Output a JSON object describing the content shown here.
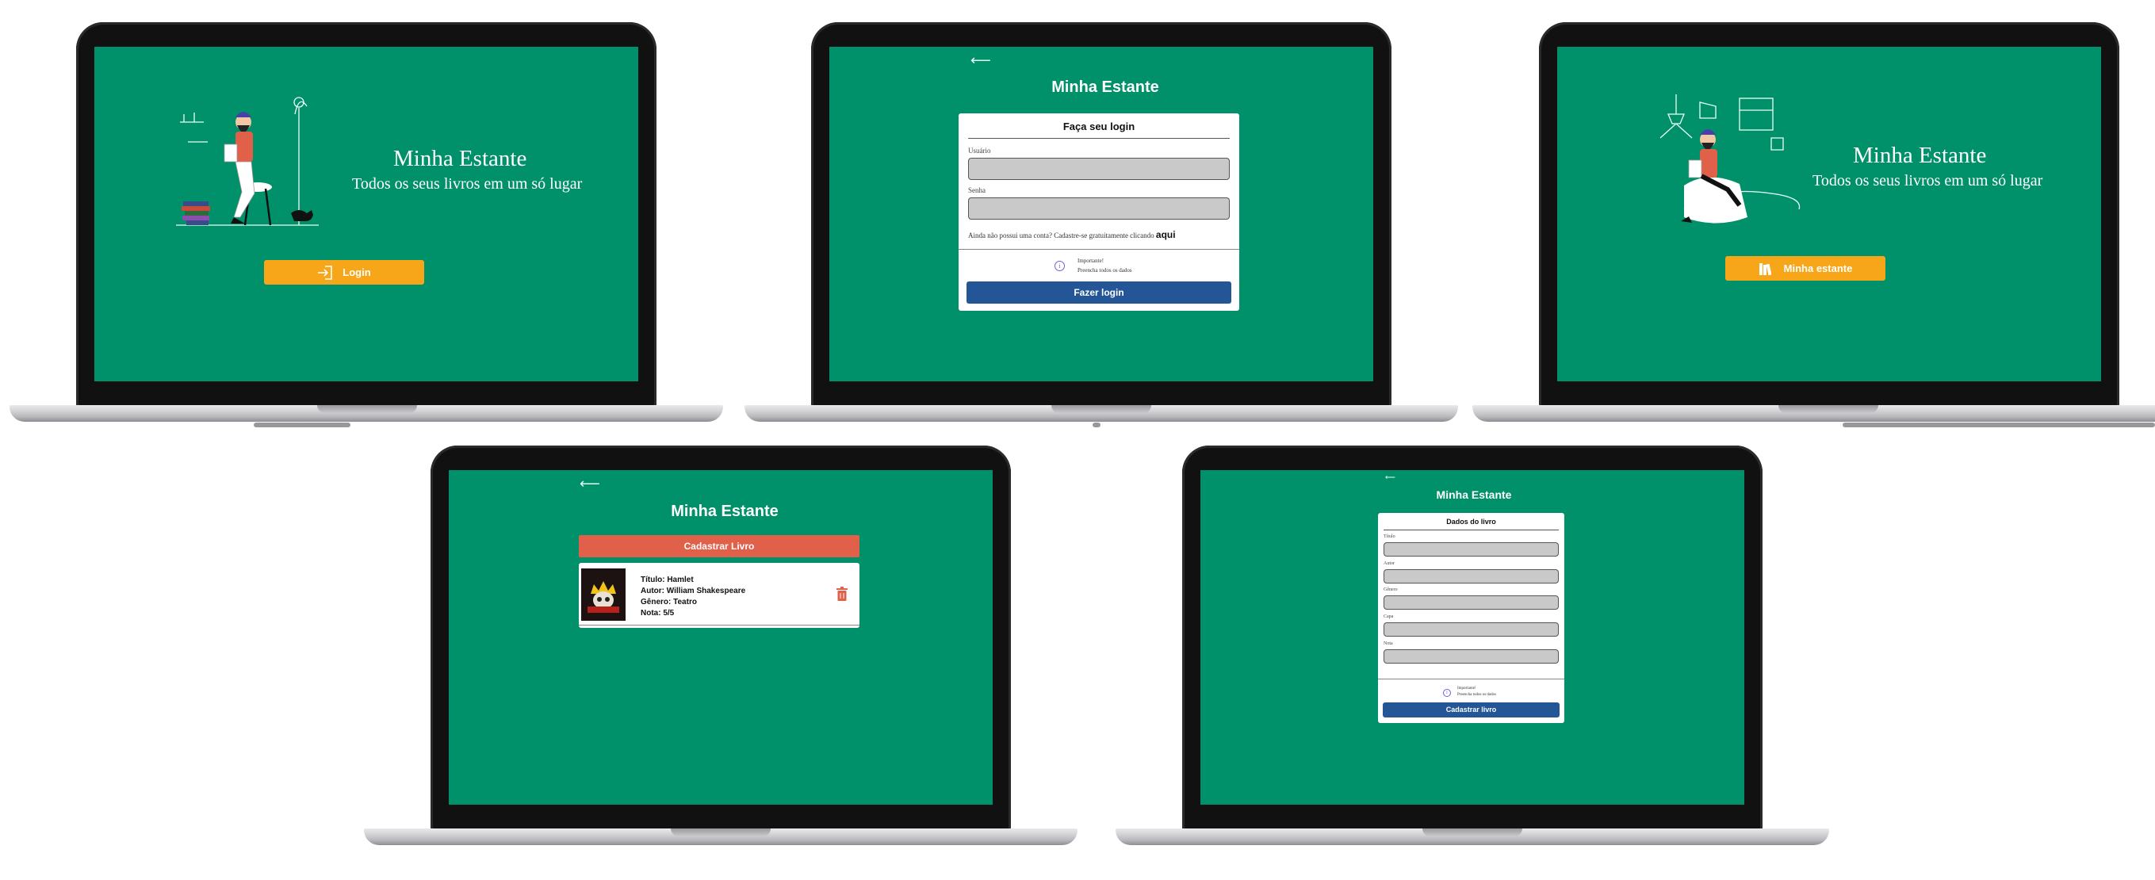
{
  "colors": {
    "screen_green": "#00916b",
    "orange": "#f6a618",
    "blue": "#245597",
    "red": "#e0604a",
    "white": "#ffffff"
  },
  "screen1": {
    "title": "Minha Estante",
    "subtitle": "Todos os seus livros em um só lugar",
    "login_button": "Login",
    "login_icon": "login-arrow-icon"
  },
  "screen2": {
    "app_title": "Minha Estante",
    "back_icon": "back-arrow-icon",
    "card_title": "Faça seu login",
    "user_label": "Usuário",
    "user_value": "",
    "password_label": "Senha",
    "password_value": "",
    "signup_text": "Ainda não possui uma conta? Cadastre-se gratuitamente clicando",
    "signup_link": "aqui",
    "notice_title": "Importante!",
    "notice_text": "Preencha todos os dados",
    "submit_button": "Fazer login"
  },
  "screen3": {
    "title": "Minha Estante",
    "subtitle": "Todos os seus livros em um só lugar",
    "shelf_button": "Minha estante",
    "shelf_icon": "books-icon"
  },
  "screen4": {
    "app_title": "Minha Estante",
    "back_icon": "back-arrow-icon",
    "add_button": "Cadastrar Livro",
    "book": {
      "title": "Título: Hamlet",
      "author": "Autor: William Shakespeare",
      "genre": "Gênero: Teatro",
      "rating": "Nota: 5/5"
    },
    "delete_icon": "trash-icon"
  },
  "screen5": {
    "app_title": "Minha Estante",
    "back_icon": "back-arrow-icon",
    "card_title": "Dados do livro",
    "fields": [
      {
        "label": "Título",
        "value": ""
      },
      {
        "label": "Autor",
        "value": ""
      },
      {
        "label": "Gênero",
        "value": ""
      },
      {
        "label": "Capa",
        "value": ""
      },
      {
        "label": "Nota",
        "value": ""
      }
    ],
    "notice_title": "Importante!",
    "notice_text": "Preencha todos os dados",
    "submit_button": "Cadastrar livro"
  }
}
